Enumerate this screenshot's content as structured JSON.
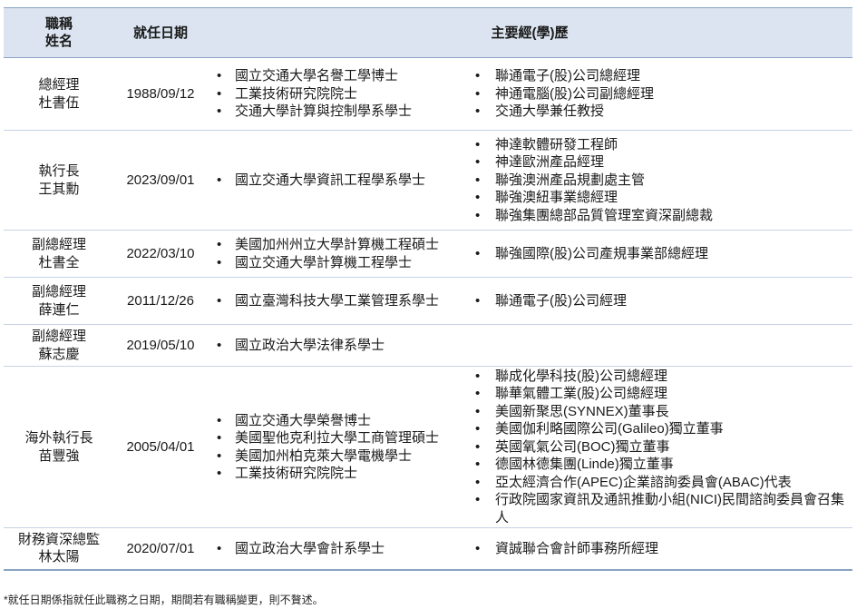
{
  "header": {
    "title_name_line1": "職稱",
    "title_name_line2": "姓名",
    "date": "就任日期",
    "experience": "主要經(學)歷"
  },
  "rows": [
    {
      "title": "總經理",
      "name": "杜書伍",
      "date": "1988/09/12",
      "education": [
        "國立交通大學名譽工學博士",
        "工業技術研究院院士",
        "交通大學計算與控制學系學士"
      ],
      "experience": [
        "聯通電子(股)公司總經理",
        "神通電腦(股)公司副總經理",
        "交通大學兼任教授"
      ]
    },
    {
      "title": "執行長",
      "name": "王其勳",
      "date": "2023/09/01",
      "education": [
        "國立交通大學資訊工程學系學士"
      ],
      "experience": [
        "神達軟體研發工程師",
        "神達歐洲產品經理",
        "聯強澳洲產品規劃處主管",
        "聯強澳紐事業總經理",
        "聯強集團總部品質管理室資深副總裁"
      ]
    },
    {
      "title": "副總經理",
      "name": "杜書全",
      "date": "2022/03/10",
      "education": [
        "美國加州州立大學計算機工程碩士",
        "國立交通大學計算機工程學士"
      ],
      "experience": [
        "聯強國際(股)公司產規事業部總經理"
      ]
    },
    {
      "title": "副總經理",
      "name": "薛連仁",
      "date": "2011/12/26",
      "education": [
        "國立臺灣科技大學工業管理系學士"
      ],
      "experience": [
        "聯通電子(股)公司經理"
      ]
    },
    {
      "title": "副總經理",
      "name": "蘇志慶",
      "date": "2019/05/10",
      "education": [
        "國立政治大學法律系學士"
      ],
      "experience": []
    },
    {
      "title": "海外執行長",
      "name": "苗豐強",
      "date": "2005/04/01",
      "education": [
        "國立交通大學榮譽博士",
        "美國聖他克利拉大學工商管理碩士",
        "美國加州柏克萊大學電機學士",
        "工業技術研究院院士"
      ],
      "experience": [
        "聯成化學科技(股)公司總經理",
        "聯華氣體工業(股)公司總經理",
        "美國新聚思(SYNNEX)董事長",
        "美國伽利略國際公司(Galileo)獨立董事",
        "英國氧氣公司(BOC)獨立董事",
        "德國林德集團(Linde)獨立董事",
        "亞太經濟合作(APEC)企業諮詢委員會(ABAC)代表",
        "行政院國家資訊及通訊推動小組(NICI)民間諮詢委員會召集人"
      ]
    },
    {
      "title": "財務資深總監",
      "name": "林太陽",
      "date": "2020/07/01",
      "education": [
        "國立政治大學會計系學士"
      ],
      "experience": [
        "資誠聯合會計師事務所經理"
      ]
    }
  ],
  "footnote": "*就任日期係指就任此職務之日期，期間若有職稱變更，則不贅述。"
}
